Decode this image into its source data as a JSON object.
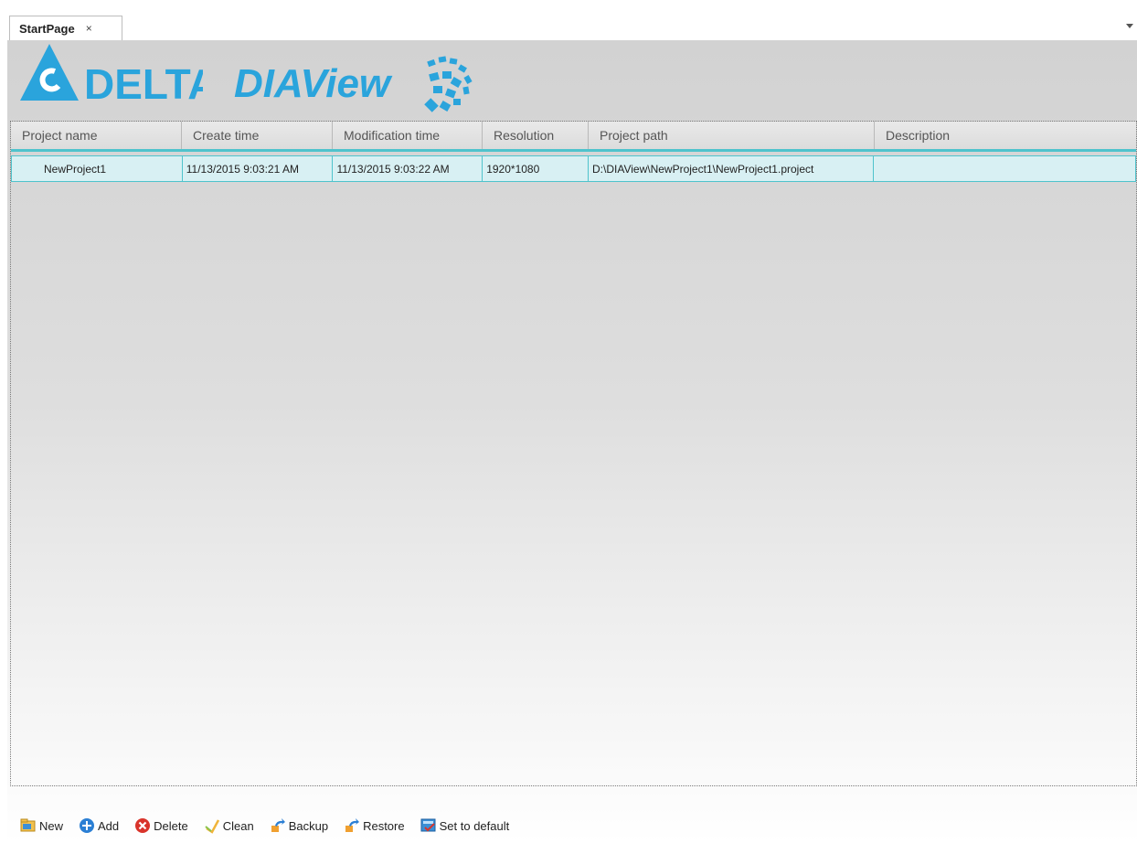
{
  "tabs": [
    {
      "label": "StartPage",
      "close_symbol": "×"
    }
  ],
  "logos": {
    "brand": "DELTA",
    "product": "DIAView",
    "brand_color": "#2aa4dc"
  },
  "table": {
    "columns": [
      "Project name",
      "Create time",
      "Modification time",
      "Resolution",
      "Project path",
      "Description"
    ],
    "rows": [
      [
        "NewProject1",
        "11/13/2015 9:03:21 AM",
        "11/13/2015 9:03:22 AM",
        "1920*1080",
        "D:\\DIAView\\NewProject1\\NewProject1.project",
        ""
      ]
    ]
  },
  "toolbar": {
    "buttons": [
      {
        "label": "New",
        "icon": "new-folder-icon"
      },
      {
        "label": "Add",
        "icon": "add-icon"
      },
      {
        "label": "Delete",
        "icon": "delete-icon"
      },
      {
        "label": "Clean",
        "icon": "clean-icon"
      },
      {
        "label": "Backup",
        "icon": "backup-icon"
      },
      {
        "label": "Restore",
        "icon": "restore-icon"
      },
      {
        "label": "Set to default",
        "icon": "set-default-icon"
      }
    ]
  },
  "colors": {
    "accent": "#4fc3cc",
    "selected_row": "#d8f0f3"
  }
}
